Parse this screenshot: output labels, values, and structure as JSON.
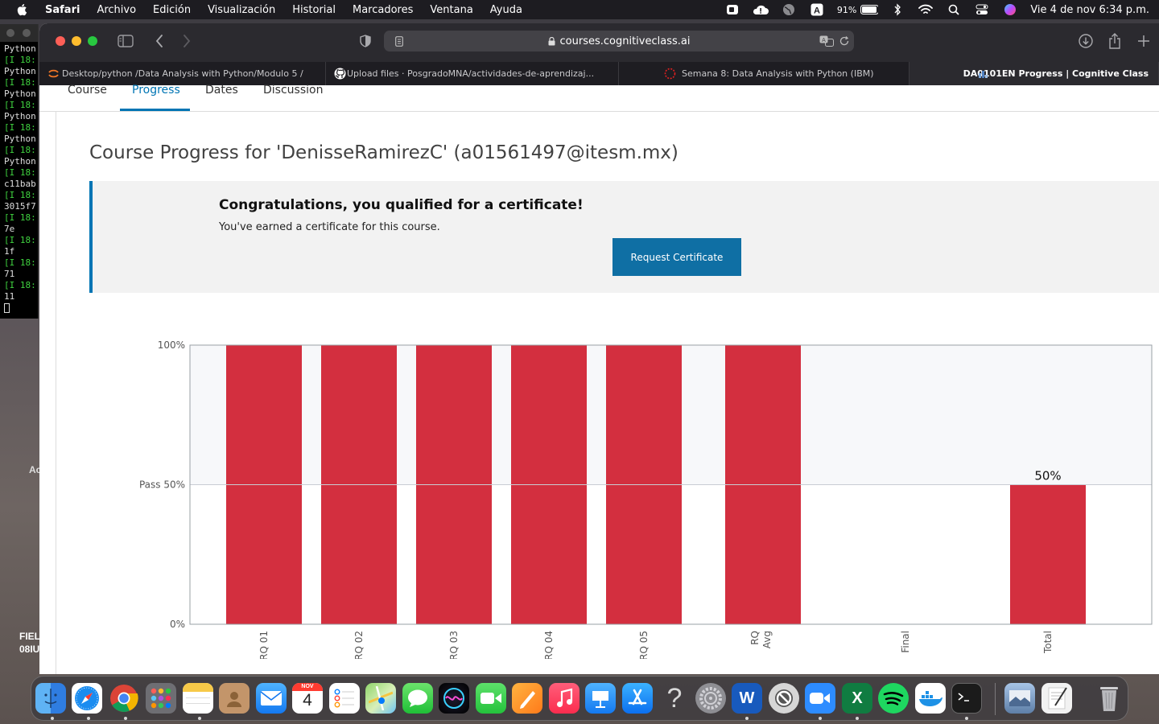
{
  "menubar": {
    "app": "Safari",
    "items": [
      "Archivo",
      "Edición",
      "Visualización",
      "Historial",
      "Marcadores",
      "Ventana",
      "Ayuda"
    ],
    "battery": "91%",
    "clock": "Vie 4 de nov  6:34 p.m."
  },
  "terminal": {
    "lines": [
      "Python",
      "[I 18:",
      "Python",
      "[I 18:",
      "Python",
      "[I 18:",
      "Python",
      "[I 18:",
      "Python",
      "[I 18:",
      "Python",
      "[I 18:",
      "c11bab",
      "[I 18:",
      "3015f7",
      "[I 18:",
      "7e",
      "[I 18:",
      "1f",
      "[I 18:",
      "71",
      "[I 18:",
      "11"
    ]
  },
  "desktop": {
    "label1": "Ac",
    "label2": "FIEL",
    "label3": "08IU"
  },
  "browser": {
    "url": "courses.cognitiveclass.ai",
    "tabs": [
      {
        "title": "Desktop/python /Data Analysis with Python/Modulo 5 /"
      },
      {
        "title": "Upload files · PosgradoMNA/actividades-de-aprendizaj..."
      },
      {
        "title": "Semana 8: Data Analysis with Python (IBM)"
      },
      {
        "title": "DA0101EN Progress | Cognitive Class"
      }
    ]
  },
  "course_nav": {
    "course": "Course",
    "progress": "Progress",
    "dates": "Dates",
    "discussion": "Discussion"
  },
  "page": {
    "title": "Course Progress for 'DenisseRamirezC' (a01561497@itesm.mx)",
    "cert_title": "Congratulations, you qualified for a certificate!",
    "cert_text": "You've earned a certificate for this course.",
    "cert_button": "Request Certificate"
  },
  "chart_data": {
    "type": "bar",
    "categories": [
      "RQ 01",
      "RQ 02",
      "RQ 03",
      "RQ 04",
      "RQ 05",
      "RQ Avg",
      "Final",
      "Total"
    ],
    "values": [
      100,
      100,
      100,
      100,
      100,
      100,
      0,
      50
    ],
    "ylim": [
      0,
      100
    ],
    "y_ticks": [
      {
        "value": 0,
        "label": "0%"
      },
      {
        "value": 50,
        "label": "Pass 50%"
      },
      {
        "value": 100,
        "label": "100%"
      }
    ],
    "pass_line": 50,
    "data_labels": [
      {
        "category": "Total",
        "label": "50%"
      }
    ],
    "bar_color": "#d32f3f",
    "pass_band_color": "#f7f8fa",
    "grid": false
  },
  "dock": {
    "icons": [
      "finder-icon",
      "safari-icon",
      "chrome-icon",
      "launchpad-icon",
      "notes-icon",
      "contacts-icon",
      "mail-icon",
      "calendar-icon",
      "reminders-icon",
      "maps-icon",
      "messages-icon",
      "siri-icon",
      "facetime-icon",
      "pages-icon",
      "music-icon",
      "keynote-icon",
      "appstore-icon",
      "help-icon",
      "system-preferences-icon",
      "word-icon",
      "blocked-app-icon",
      "zoom-icon",
      "excel-icon",
      "spotify-icon",
      "docker-icon",
      "terminal-icon",
      "preview-icon",
      "textedit-icon",
      "trash-icon"
    ],
    "calendar_month": "NOV",
    "calendar_day": "4",
    "word_letter": "W",
    "excel_letter": "X",
    "help_glyph": "?"
  }
}
